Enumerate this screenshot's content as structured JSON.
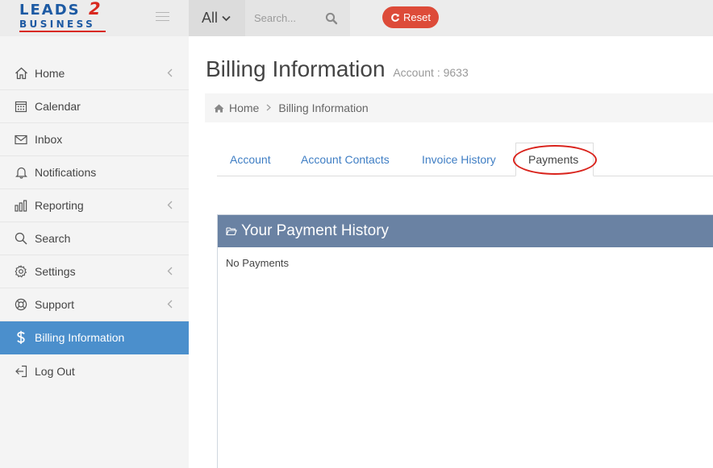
{
  "brand": {
    "line1": "LEADS",
    "number": "2",
    "line2": "BUSINESS",
    "colors": {
      "blue": "#1d5aa3",
      "red": "#d8281f"
    }
  },
  "topbar": {
    "scope_label": "All",
    "search_placeholder": "Search...",
    "reset_label": "Reset",
    "reset_color": "#dd4b39"
  },
  "sidebar": {
    "active_color": "#4b8fcc",
    "items": [
      {
        "label": "Home",
        "icon": "home-icon",
        "has_submenu": true
      },
      {
        "label": "Calendar",
        "icon": "calendar-icon",
        "has_submenu": false
      },
      {
        "label": "Inbox",
        "icon": "envelope-icon",
        "has_submenu": false
      },
      {
        "label": "Notifications",
        "icon": "bell-icon",
        "has_submenu": false
      },
      {
        "label": "Reporting",
        "icon": "bar-chart-icon",
        "has_submenu": true
      },
      {
        "label": "Search",
        "icon": "search-icon",
        "has_submenu": false
      },
      {
        "label": "Settings",
        "icon": "gear-icon",
        "has_submenu": true
      },
      {
        "label": "Support",
        "icon": "life-ring-icon",
        "has_submenu": true
      },
      {
        "label": "Billing Information",
        "icon": "dollar-icon",
        "has_submenu": false,
        "active": true
      },
      {
        "label": "Log Out",
        "icon": "logout-icon",
        "has_submenu": false
      }
    ]
  },
  "page": {
    "title": "Billing Information",
    "subtitle": "Account : 9633"
  },
  "breadcrumb": {
    "home": "Home",
    "current": "Billing Information"
  },
  "tabs": [
    {
      "label": "Account"
    },
    {
      "label": "Account Contacts"
    },
    {
      "label": "Invoice History"
    },
    {
      "label": "Payments",
      "active": true
    }
  ],
  "panel": {
    "title": "Your Payment History",
    "header_color": "#6a82a3",
    "empty_text": "No Payments"
  }
}
